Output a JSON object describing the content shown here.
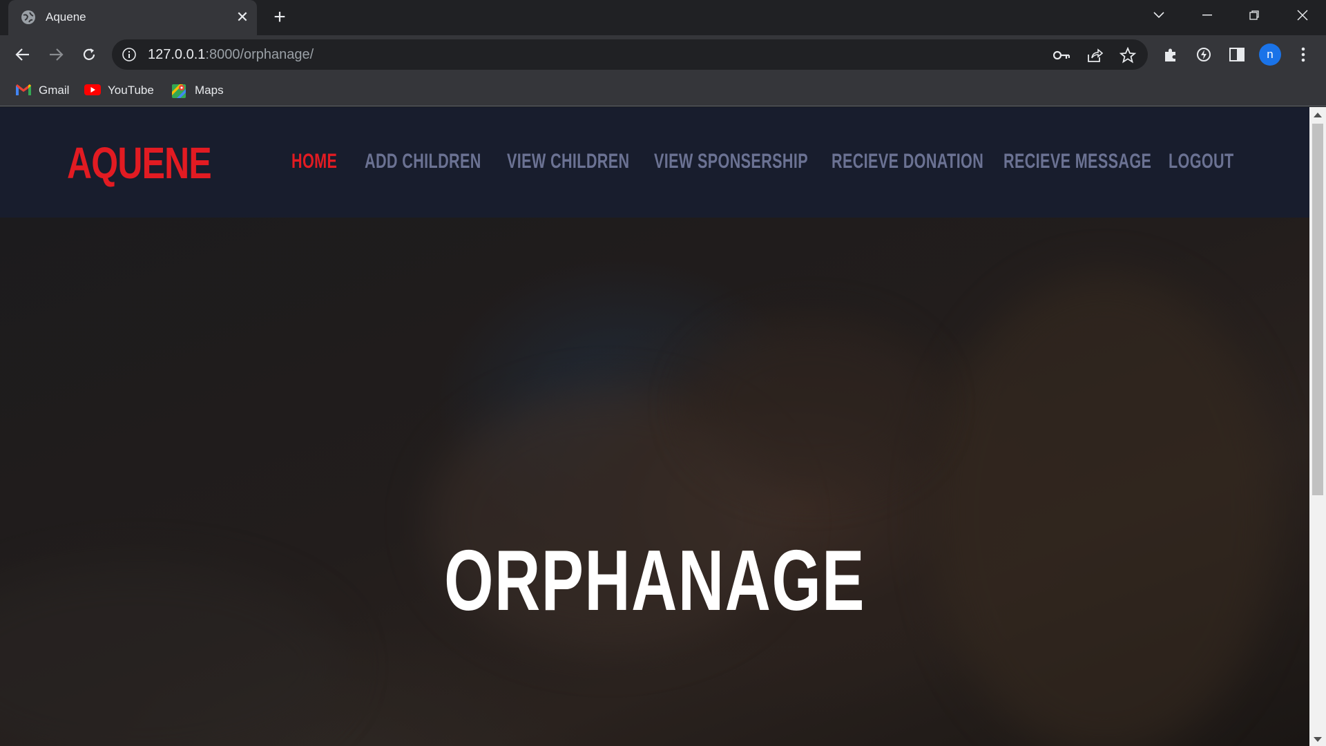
{
  "browser": {
    "tab": {
      "title": "Aquene",
      "favicon": "globe-icon"
    },
    "address": {
      "host": "127.0.0.1",
      "rest": ":8000/orphanage/"
    },
    "profile_initial": "n",
    "bookmarks": [
      {
        "label": "Gmail",
        "icon": "gmail-icon"
      },
      {
        "label": "YouTube",
        "icon": "youtube-icon"
      },
      {
        "label": "Maps",
        "icon": "maps-icon"
      }
    ]
  },
  "site": {
    "logo": "AQUENE",
    "nav": [
      {
        "label": "HOME",
        "active": true
      },
      {
        "label": "ADD CHILDREN",
        "active": false
      },
      {
        "label": "VIEW CHILDREN",
        "active": false
      },
      {
        "label": "VIEW SPONSERSHIP",
        "active": false
      },
      {
        "label": "RECIEVE DONATION",
        "active": false
      },
      {
        "label": "RECIEVE MESSAGE",
        "active": false
      },
      {
        "label": "LOGOUT",
        "active": false
      }
    ],
    "hero_title": "ORPHANAGE"
  },
  "colors": {
    "accent": "#e21b22",
    "nav_text": "#6b7293",
    "header_bg": "#181d2d"
  }
}
